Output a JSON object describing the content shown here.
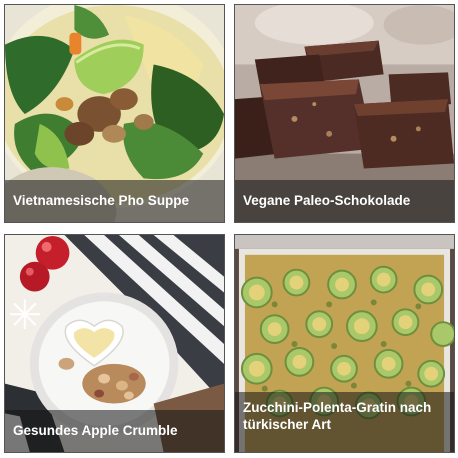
{
  "recipes": [
    {
      "title": "Vietnamesische Pho Suppe",
      "image": "bowl of pho soup with greens, mushrooms and lime wedge"
    },
    {
      "title": "Vegane Paleo-Schokolade",
      "image": "stacked chocolate brownie squares on a board"
    },
    {
      "title": "Gesundes Apple Crumble",
      "image": "plate of apple crumble with heart-shaped bowl of cream, red baubles, striped napkin"
    },
    {
      "title": "Zucchini-Polenta-Gratin nach türkischer Art",
      "image": "baking dish of zucchini slices in polenta gratin"
    }
  ]
}
